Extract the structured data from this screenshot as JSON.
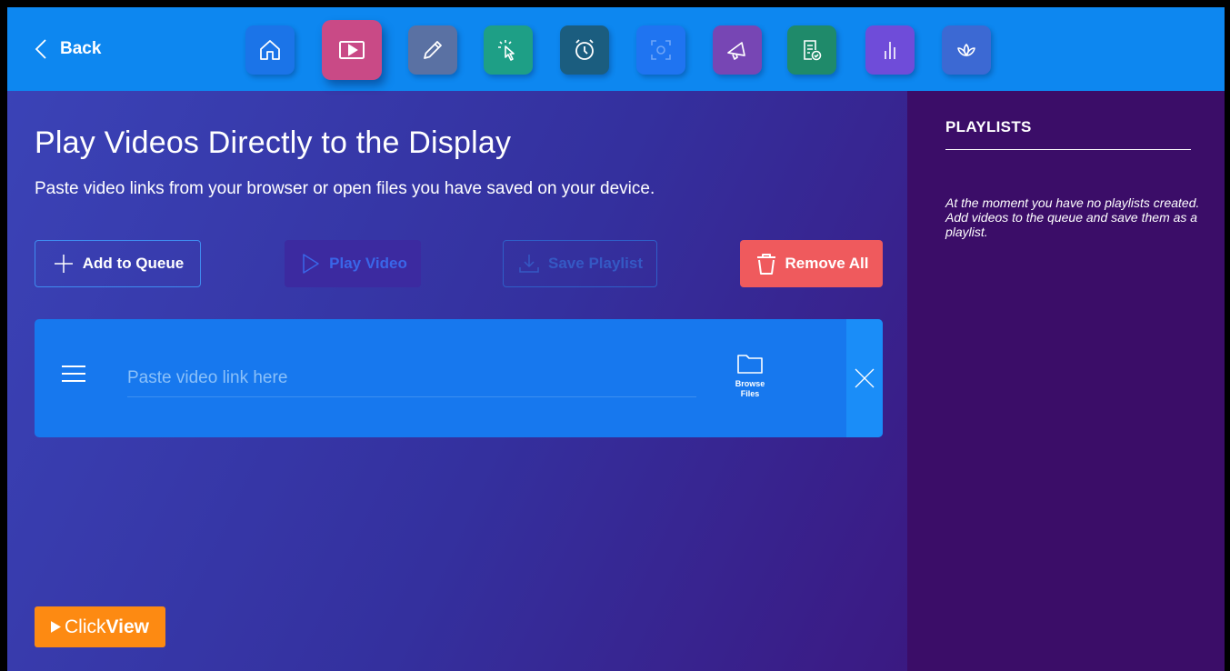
{
  "topbar": {
    "back_label": "Back",
    "tools": [
      {
        "name": "home-icon",
        "color": "#1b74e8"
      },
      {
        "name": "video-play-icon",
        "color": "#c94a86",
        "active": true
      },
      {
        "name": "pencil-icon",
        "color": "#5a71a3"
      },
      {
        "name": "pointer-click-icon",
        "color": "#1e9f86"
      },
      {
        "name": "alarm-clock-icon",
        "color": "#1b5d7f"
      },
      {
        "name": "screen-capture-icon",
        "color": "#1f74f1"
      },
      {
        "name": "megaphone-icon",
        "color": "#7746b4"
      },
      {
        "name": "document-check-icon",
        "color": "#1f8a6a"
      },
      {
        "name": "bar-levels-icon",
        "color": "#6f4cd9"
      },
      {
        "name": "lotus-icon",
        "color": "#3c69d3"
      }
    ]
  },
  "main": {
    "title": "Play Videos Directly to the Display",
    "subtitle": "Paste video links from your browser or open files you have saved on your device.",
    "buttons": {
      "add_queue": "Add to Queue",
      "play_video": "Play Video",
      "save_playlist": "Save Playlist",
      "remove_all": "Remove All"
    },
    "queue": {
      "link_placeholder": "Paste video link here",
      "link_value": "",
      "browse_line1": "Browse",
      "browse_line2": "Files"
    },
    "logo": {
      "part1": "Click",
      "part2": "View"
    }
  },
  "sidebar": {
    "heading": "PLAYLISTS",
    "empty_message": "At the moment you have no playlists created. Add videos to the queue and save them as a playlist."
  },
  "colors": {
    "topbar": "#0d87f0",
    "remove": "#ef5a5d",
    "card": "#1778ee",
    "logo": "#fd8a12",
    "sidebar": "#3b0d68"
  }
}
